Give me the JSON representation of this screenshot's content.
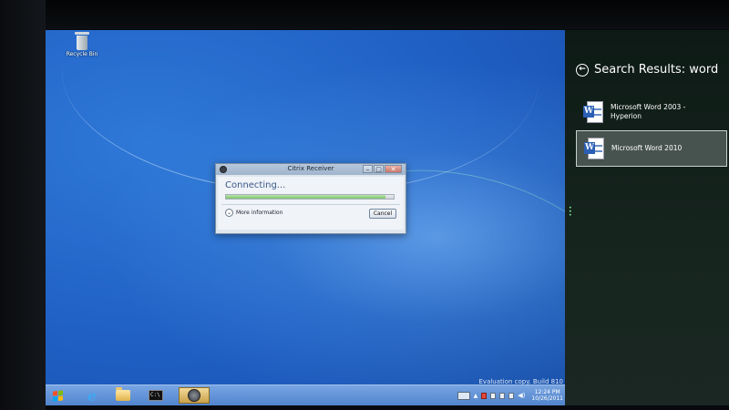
{
  "desktop": {
    "recycle_bin_label": "Recycle Bin",
    "watermark": "Evaluation copy. Build 810"
  },
  "dialog": {
    "title": "Citrix Receiver",
    "status": "Connecting...",
    "progress": 0.95,
    "more_info_label": "More information",
    "cancel_label": "Cancel",
    "title_controls": [
      "–",
      "□",
      "✕"
    ]
  },
  "taskbar": {
    "apps": [
      "start",
      "internet-explorer",
      "file-explorer",
      "command-prompt",
      "citrix-receiver"
    ],
    "clock_time": "12:24 PM",
    "clock_date": "10/26/2011"
  },
  "search_pane": {
    "title": "Search Results: word",
    "results": [
      {
        "label_line1": "Microsoft Word 2003 -",
        "label_line2": "Hyperion",
        "selected": false
      },
      {
        "label_line1": "Microsoft Word 2010",
        "label_line2": "",
        "selected": true
      }
    ]
  },
  "colors": {
    "desktop_blue": "#1f5fc4",
    "pane_bg": "#17251f",
    "selected_result_bg": "#47534e",
    "word_blue": "#2b5fb4"
  }
}
